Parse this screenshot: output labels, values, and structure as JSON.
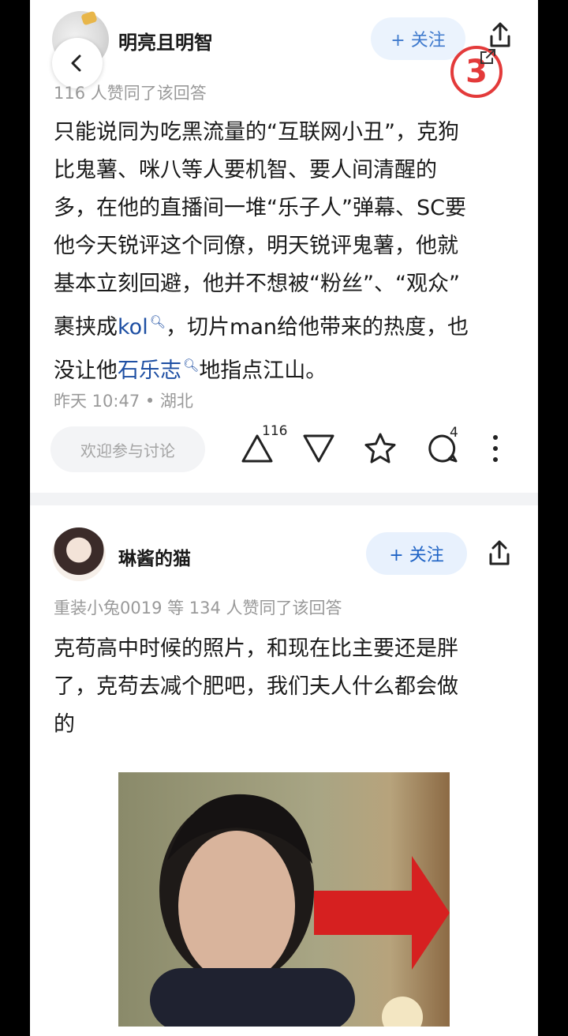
{
  "answer1": {
    "author": "明亮且明智",
    "follow_label": "+ 关注",
    "badge_count": "3",
    "liked_text": "116 人赞同了该回答",
    "body": {
      "p1": "只能说同为吃黑流量的“互联网小丑”，克狗",
      "p2": "比鬼薯、咪八等人要机智、要人间清醒的",
      "p3": "多，在他的直播间一堆“乐子人”弹幕、SC要",
      "p4": "他今天锐评这个同僚，明天锐评鬼薯，他就",
      "p5": "基本立刻回避，他并不想被“粉丝”、“观众”",
      "p6_pre": "裹挟成",
      "p6_link": "kol",
      "p6_post": "，切片man给他带来的热度，也",
      "p7_pre": "没让他",
      "p7_link": "石乐志",
      "p7_post": "地指点江山。"
    },
    "meta": "昨天 10:47 • 湖北",
    "discuss_placeholder": "欢迎参与讨论",
    "upvote_count": "116",
    "comment_count": "4",
    "icons": [
      "back-icon",
      "share-icon",
      "external-icon",
      "upvote-icon",
      "downvote-icon",
      "star-icon",
      "comment-icon",
      "more-icon",
      "search-icon"
    ]
  },
  "answer2": {
    "author": "琳酱的猫",
    "follow_label": "+ 关注",
    "liked_text": "重装小兔0019 等 134 人赞同了该回答",
    "body": {
      "p1": "克苟高中时候的照片，和现在比主要还是胖",
      "p2": "了，克苟去减个肥吧，我们夫人什么都会做",
      "p3": "的"
    }
  },
  "colors": {
    "accent": "#1e63c5",
    "badge": "#e33a3a",
    "link": "#1e4fa3"
  }
}
